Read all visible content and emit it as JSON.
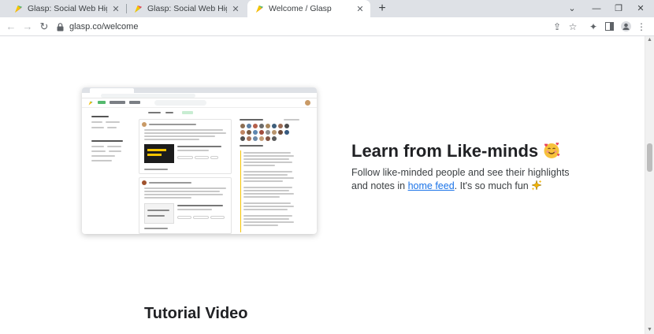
{
  "browser": {
    "tabs": [
      {
        "title": "Glasp: Social Web Highlighter",
        "active": false
      },
      {
        "title": "Glasp: Social Web Highlighter",
        "active": false
      },
      {
        "title": "Welcome / Glasp",
        "active": true
      }
    ],
    "close_glyph": "✕",
    "new_tab_glyph": "+",
    "window_controls": {
      "dropdown": "⌄",
      "minimize": "—",
      "restore": "❐",
      "close": "✕"
    },
    "address": "glasp.co/welcome",
    "colors": {
      "tabstrip": "#dee1e6",
      "accent_yellow": "#f5c400",
      "accent_green": "#55b96e",
      "link": "#1a73e8"
    }
  },
  "page": {
    "feature": {
      "title": "Learn from Like-minds",
      "title_emoji": "smiling-face-with-hearts",
      "description_before": "Follow like-minded people and see their highlights and notes in ",
      "link_text": "home feed",
      "description_after": ". It's so much fun",
      "trailing_emoji": "sparkles"
    },
    "tutorial_heading": "Tutorial Video"
  }
}
